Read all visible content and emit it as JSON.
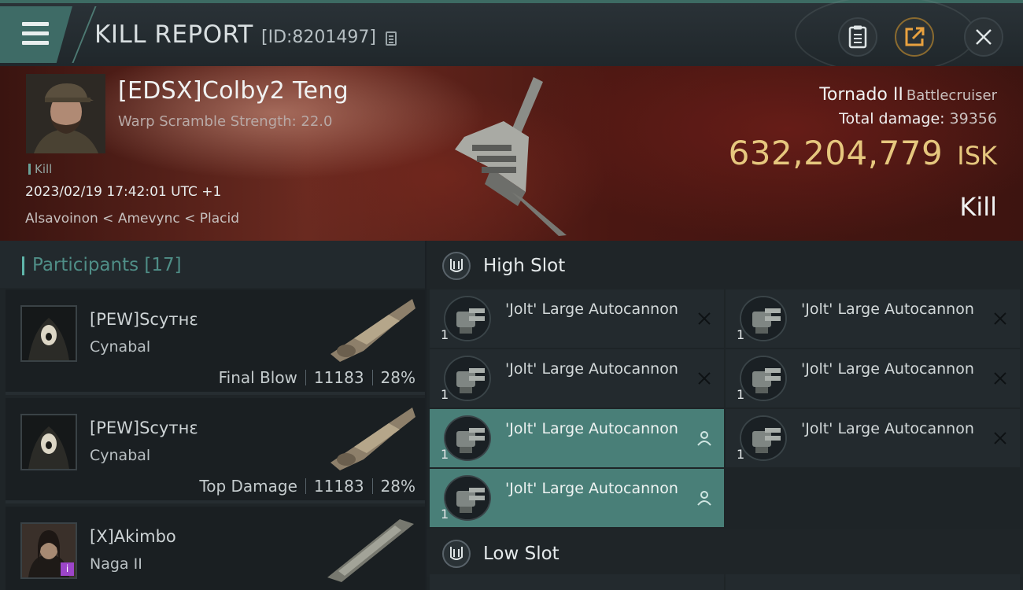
{
  "header": {
    "title": "KILL REPORT",
    "report_id": "[ID:8201497]",
    "menu_icon": "hamburger-menu-icon",
    "buttons": [
      "clipboard-icon",
      "share-icon",
      "close-icon"
    ],
    "colors": {
      "accent": "#3e6b66",
      "gold": "#e6c77e"
    }
  },
  "victim": {
    "pilot_name": "[EDSX]Colby2 Teng",
    "scramble": "Warp Scramble Strength: 22.0",
    "kill_tag": "Kill",
    "datetime": "2023/02/19 17:42:01 UTC +1",
    "location": "Alsavoinon < Amevync < Placid",
    "ship_name": "Tornado II",
    "ship_class": "Battlecruiser",
    "total_damage_label": "Total damage:",
    "total_damage": "39356",
    "isk_value": "632,204,779",
    "isk_unit": "ISK",
    "result": "Kill"
  },
  "participants": {
    "title": "Participants [17]",
    "rows": [
      {
        "name": "[PEW]Scyтнε",
        "ship": "Cynabal",
        "role": "Final Blow",
        "damage": "11183",
        "percent": "28%"
      },
      {
        "name": "[PEW]Scyтнε",
        "ship": "Cynabal",
        "role": "Top Damage",
        "damage": "11183",
        "percent": "28%"
      },
      {
        "name": "[X]Akimbo",
        "ship": "Naga II",
        "role": "",
        "damage": "",
        "percent": "",
        "badge": "i"
      }
    ]
  },
  "slots": {
    "high_slot_title": "High Slot",
    "low_slot_title": "Low Slot",
    "high_modules": [
      {
        "qty": "1",
        "name": "'Jolt' Large Autocannon",
        "state": "destroyed"
      },
      {
        "qty": "1",
        "name": "'Jolt' Large Autocannon",
        "state": "destroyed"
      },
      {
        "qty": "1",
        "name": "'Jolt' Large Autocannon",
        "state": "destroyed"
      },
      {
        "qty": "1",
        "name": "'Jolt' Large Autocannon",
        "state": "destroyed"
      },
      {
        "qty": "1",
        "name": "'Jolt' Large Autocannon",
        "state": "dropped"
      },
      {
        "qty": "1",
        "name": "'Jolt' Large Autocannon",
        "state": "destroyed"
      },
      {
        "qty": "1",
        "name": "'Jolt' Large Autocannon",
        "state": "dropped"
      }
    ]
  }
}
